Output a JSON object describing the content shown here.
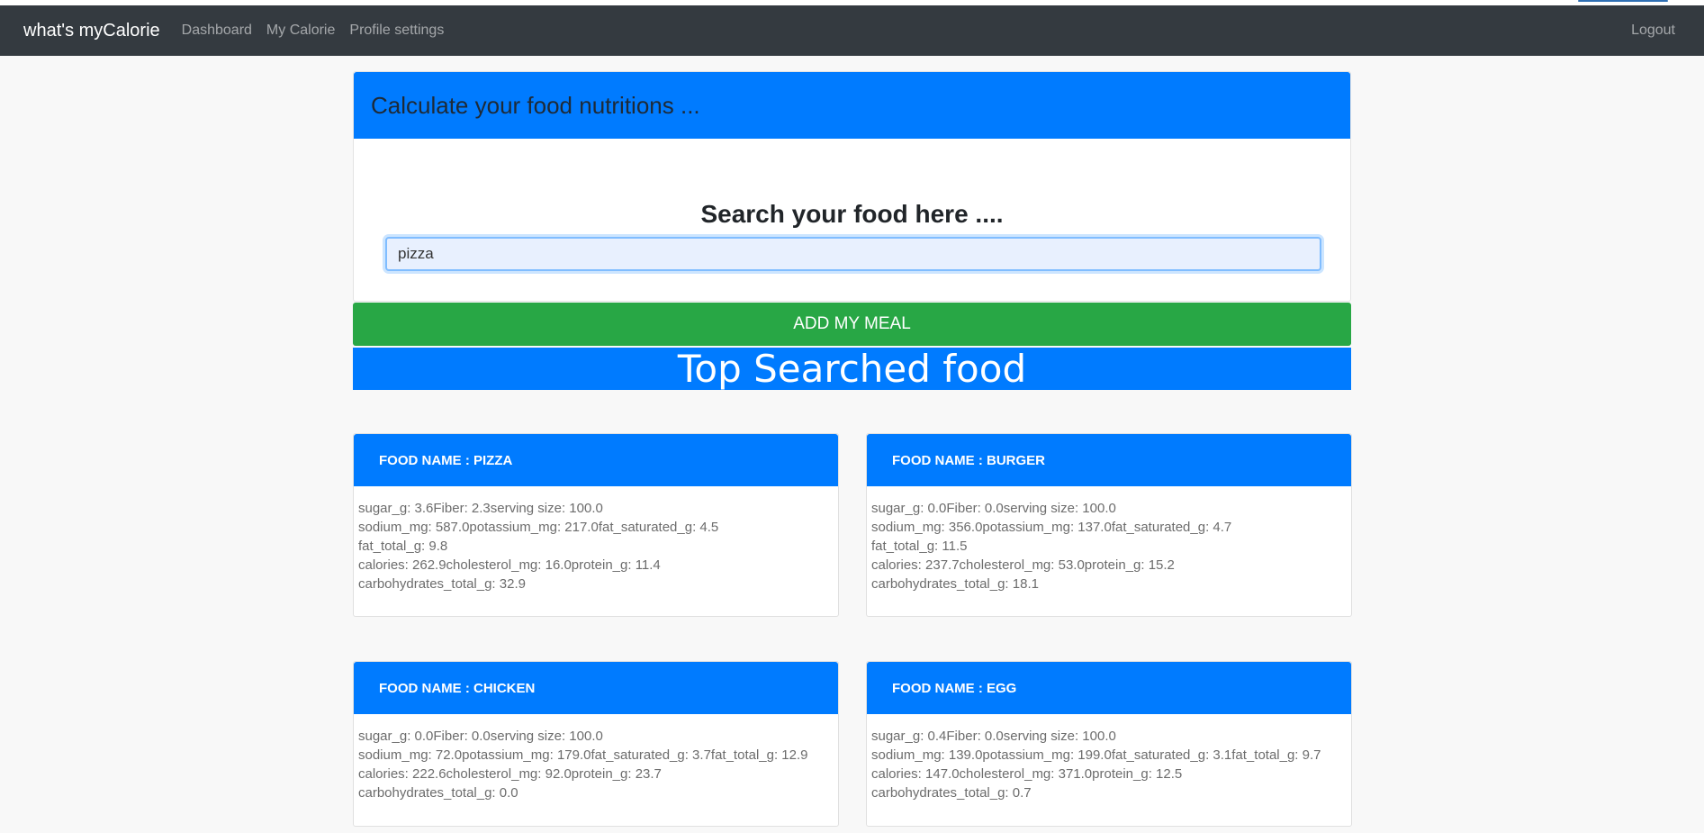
{
  "navbar": {
    "brand": "what's myCalorie",
    "links": [
      "Dashboard",
      "My Calorie",
      "Profile settings"
    ],
    "logout": "Logout"
  },
  "calculator": {
    "title": "Calculate your food nutritions ...",
    "search_heading": "Search your food here ....",
    "search_value": "pizza"
  },
  "add_meal_label": "ADD MY MEAL",
  "top_searched_title": "Top Searched food",
  "foods": [
    {
      "name": "FOOD NAME : PIZZA",
      "lines": [
        "sugar_g: 3.6Fiber: 2.3serving size: 100.0",
        "sodium_mg: 587.0potassium_mg: 217.0fat_saturated_g: 4.5",
        "fat_total_g: 9.8",
        "calories: 262.9cholesterol_mg: 16.0protein_g: 11.4",
        "carbohydrates_total_g: 32.9"
      ]
    },
    {
      "name": "FOOD NAME : BURGER",
      "lines": [
        "sugar_g: 0.0Fiber: 0.0serving size: 100.0",
        "sodium_mg: 356.0potassium_mg: 137.0fat_saturated_g: 4.7",
        "fat_total_g: 11.5",
        "calories: 237.7cholesterol_mg: 53.0protein_g: 15.2",
        "carbohydrates_total_g: 18.1"
      ]
    },
    {
      "name": "FOOD NAME : CHICKEN",
      "lines": [
        "sugar_g: 0.0Fiber: 0.0serving size: 100.0",
        "sodium_mg: 72.0potassium_mg: 179.0fat_saturated_g: 3.7fat_total_g: 12.9",
        "calories: 222.6cholesterol_mg: 92.0protein_g: 23.7",
        "carbohydrates_total_g: 0.0"
      ]
    },
    {
      "name": "FOOD NAME : EGG",
      "lines": [
        "sugar_g: 0.4Fiber: 0.0serving size: 100.0",
        "sodium_mg: 139.0potassium_mg: 199.0fat_saturated_g: 3.1fat_total_g: 9.7",
        "calories: 147.0cholesterol_mg: 371.0protein_g: 12.5",
        "carbohydrates_total_g: 0.7"
      ]
    }
  ],
  "colors": {
    "navbar": "#343a40",
    "primary": "#007bff",
    "success": "#28a745"
  }
}
